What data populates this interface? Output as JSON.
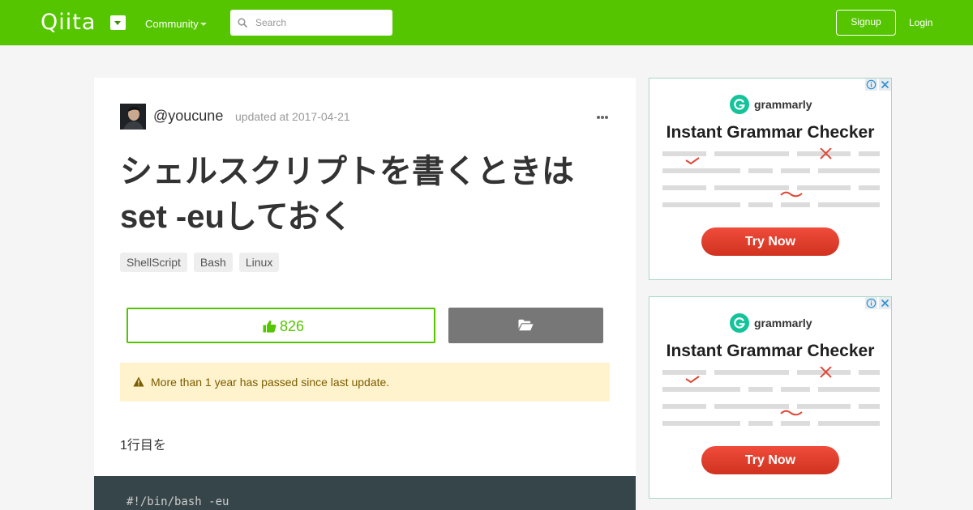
{
  "header": {
    "logo_text": "Qiita",
    "community_label": "Community",
    "search_placeholder": "Search",
    "signup_label": "Signup",
    "login_label": "Login",
    "brand_color": "#55c500"
  },
  "article": {
    "username": "@youcune",
    "updated": "updated at 2017-04-21",
    "title_line1": "シェルスクリプトを書くときは",
    "title_line2": "set -euしておく",
    "tags": [
      "ShellScript",
      "Bash",
      "Linux"
    ],
    "likes": "826",
    "alert_text": "More than 1 year has passed since last update.",
    "paragraph": "1行目を",
    "code": "#!/bin/bash -eu"
  },
  "ads": [
    {
      "brand": "grammarly",
      "headline": "Instant Grammar Checker",
      "cta": "Try Now"
    },
    {
      "brand": "grammarly",
      "headline": "Instant Grammar Checker",
      "cta": "Try Now"
    }
  ],
  "icons": {
    "search": "search-icon",
    "caret": "chevron-down-icon",
    "more": "more-horizontal-icon",
    "like": "thumbs-up-icon",
    "stock": "folder-open-icon",
    "warning": "warning-icon",
    "ad_info": "info-icon",
    "ad_close": "close-icon"
  }
}
